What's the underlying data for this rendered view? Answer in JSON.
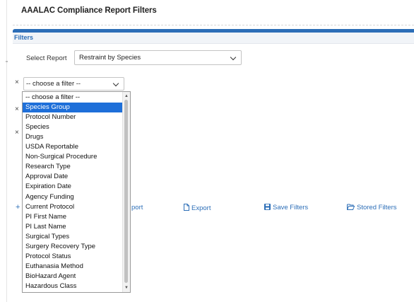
{
  "page": {
    "title": "AAALAC Compliance Report Filters"
  },
  "panel": {
    "heading": "Filters"
  },
  "report_select": {
    "label": "Select Report",
    "value": "Restraint by Species"
  },
  "filter_row": {
    "remove_symbol": "×",
    "placeholder_value": "-- choose a filter --"
  },
  "hidden_rows": {
    "remove_symbol": "×"
  },
  "dropdown": {
    "options": [
      "-- choose a filter --",
      "Species Group",
      "Protocol Number",
      "Species",
      "Drugs",
      "USDA Reportable",
      "Non-Surgical Procedure",
      "Research Type",
      "Approval Date",
      "Expiration Date",
      "Agency Funding",
      "Current Protocol",
      "PI First Name",
      "PI Last Name",
      "Surgical Types",
      "Surgery Recovery Type",
      "Protocol Status",
      "Euthanasia Method",
      "BioHazard Agent",
      "Hazardous Class"
    ],
    "selected_index": 1,
    "colors": {
      "selected_bg": "#1e6fd9",
      "selected_fg": "#ffffff"
    }
  },
  "actions": {
    "add_symbol": "+",
    "report_fragment": "port",
    "export_label": "Export",
    "save_label": "Save Filters",
    "stored_label": "Stored Filters",
    "icons": {
      "export": "file-icon",
      "save": "save-icon",
      "stored": "folder-open-icon"
    }
  },
  "theme": {
    "accent": "#2c6eb7"
  }
}
